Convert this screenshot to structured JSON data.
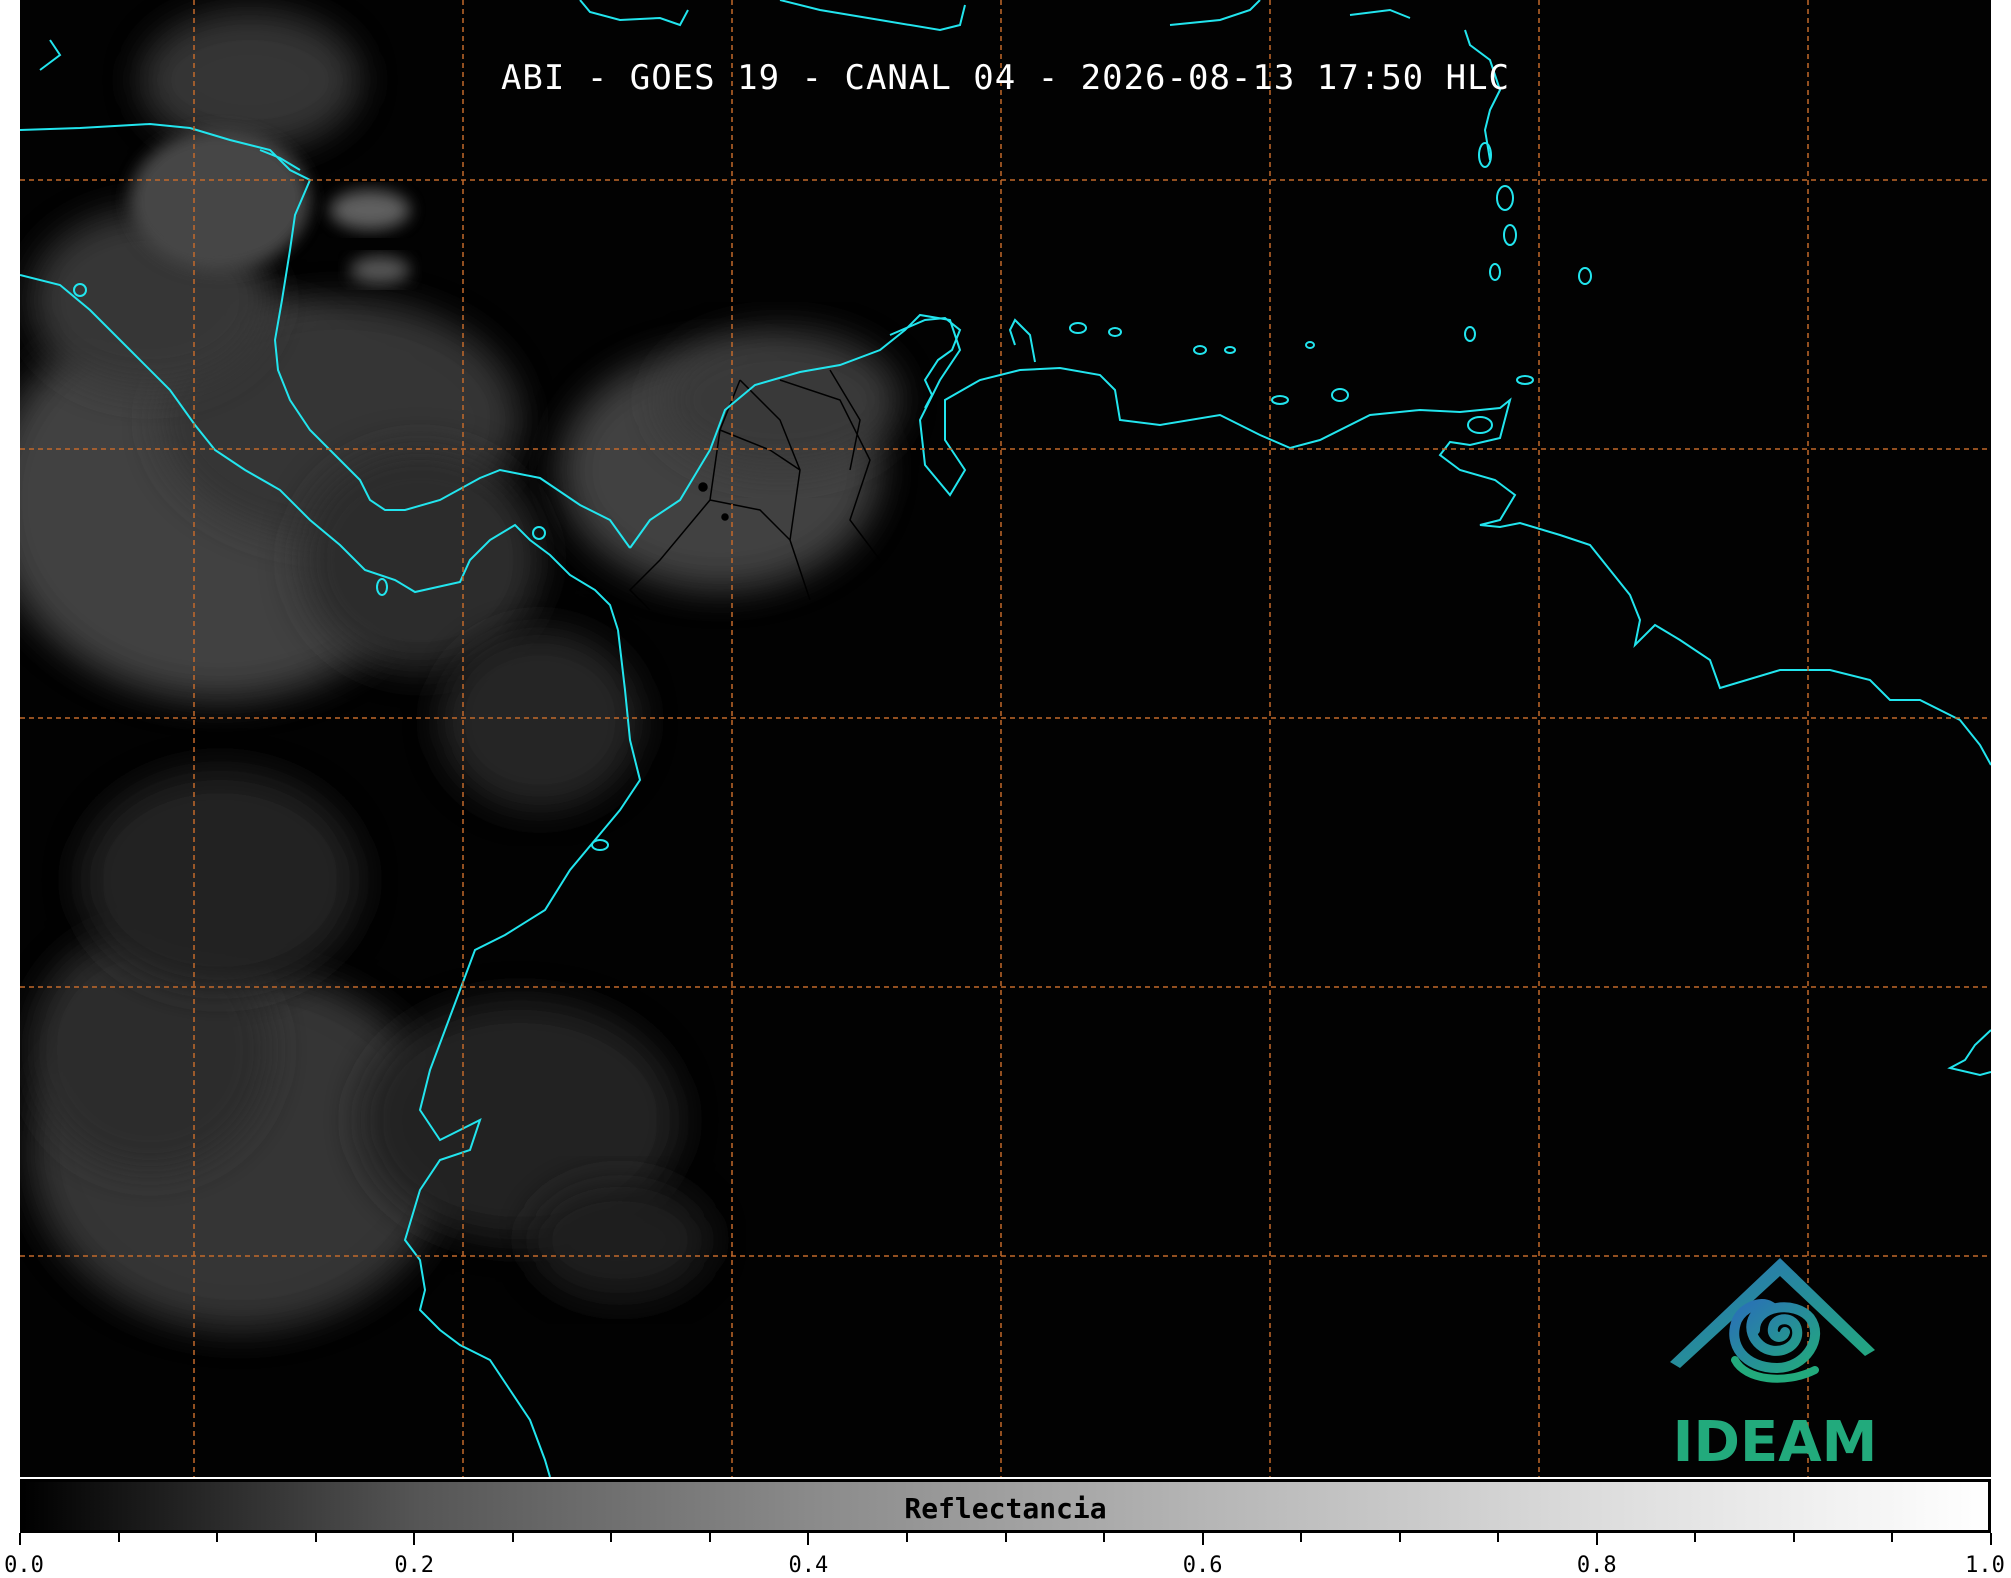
{
  "title": "ABI - GOES 19 - CANAL 04 - 2026-08-13 17:50 HLC",
  "colors": {
    "background": "#020202",
    "coastline": "#22e5ee",
    "gridline": "#c2692b",
    "borders": "#000000",
    "logo_blue": "#2a78b8",
    "logo_green": "#22aa7c"
  },
  "logo": {
    "text": "IDEAM",
    "icon": "ideam-mountain-spiral-logo"
  },
  "colorbar": {
    "label": "Reflectancia",
    "min": 0.0,
    "max": 1.0,
    "tick_labels": [
      "0.0",
      "0.2",
      "0.4",
      "0.6",
      "0.8",
      "1.0"
    ],
    "minor_ticks_between": 3
  },
  "grid": {
    "style": "dashed",
    "columns": 8,
    "rows": 6
  }
}
